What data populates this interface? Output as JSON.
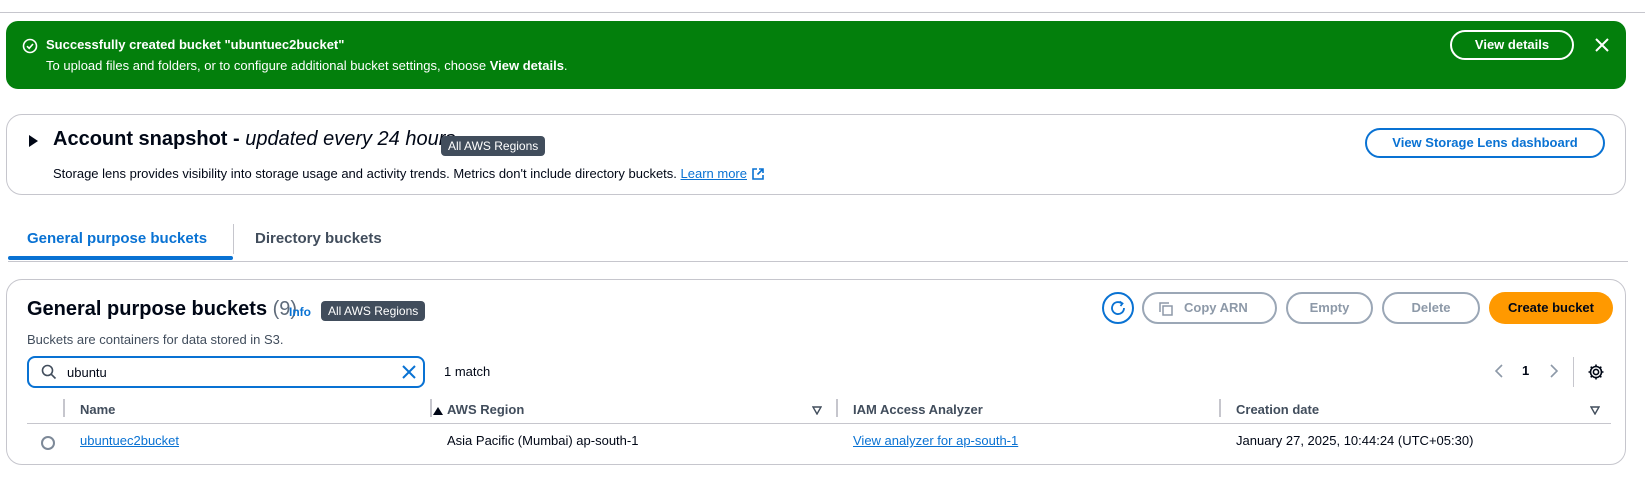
{
  "flash": {
    "title": "Successfully created bucket \"ubuntuec2bucket\"",
    "desc_prefix": "To upload files and folders, or to configure additional bucket settings, choose ",
    "desc_bold": "View details",
    "desc_suffix": ".",
    "button": "View details",
    "icons": {
      "status": "check-circle-icon",
      "close": "close-icon"
    },
    "color": "#037f0c"
  },
  "snapshot": {
    "title": "Account snapshot - ",
    "title_italic": "updated every 24 hours",
    "badge": "All AWS Regions",
    "desc": "Storage lens provides visibility into storage usage and activity trends. Metrics don't include directory buckets. ",
    "learn_more": "Learn more",
    "button": "View Storage Lens dashboard"
  },
  "tabs": [
    {
      "label": "General purpose buckets",
      "active": true
    },
    {
      "label": "Directory buckets",
      "active": false
    }
  ],
  "buckets": {
    "title": "General purpose buckets",
    "count": "(9)",
    "info": "Info",
    "badge": "All AWS Regions",
    "desc": "Buckets are containers for data stored in S3.",
    "actions": {
      "copy_arn": "Copy ARN",
      "empty": "Empty",
      "delete": "Delete",
      "create": "Create bucket"
    },
    "search": {
      "value": "ubuntu"
    },
    "match": "1 match",
    "page": "1",
    "columns": [
      "Name",
      "AWS Region",
      "IAM Access Analyzer",
      "Creation date"
    ],
    "rows": [
      {
        "name": "ubuntuec2bucket",
        "region": "Asia Pacific (Mumbai) ap-south-1",
        "analyzer": "View analyzer for ap-south-1",
        "created": "January 27, 2025, 10:44:24 (UTC+05:30)"
      }
    ]
  },
  "colors": {
    "accent": "#0972d3",
    "primary_button": "#ff9900",
    "success": "#037f0c"
  }
}
